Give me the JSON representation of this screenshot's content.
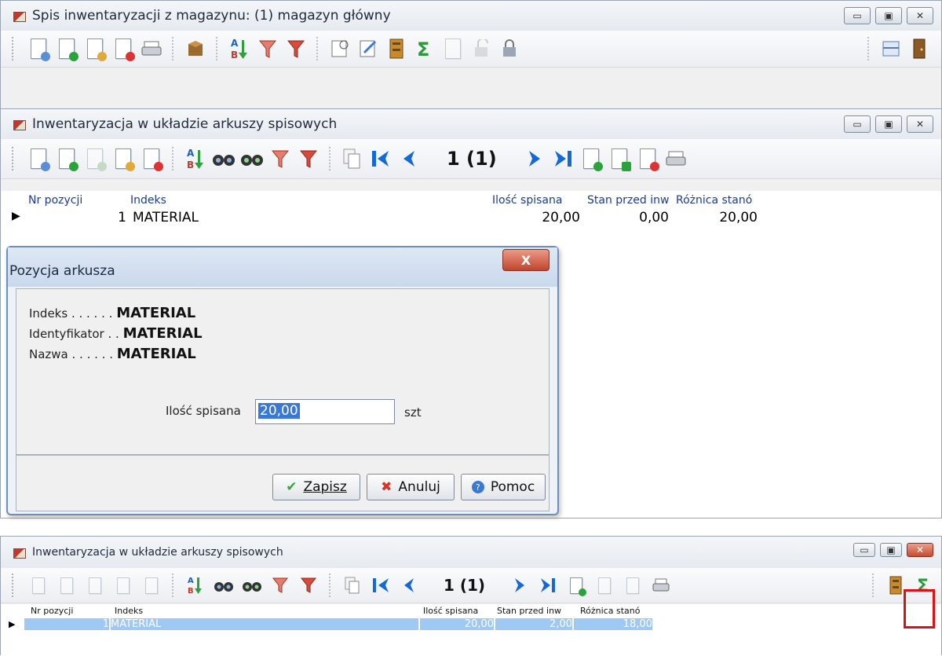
{
  "win1": {
    "title": "Spis inwentaryzacji z magazynu: (1) magazyn główny"
  },
  "win2": {
    "title": "Inwentaryzacja w układzie arkuszy spisowych",
    "page_indicator": "1 (1)",
    "columns": [
      "Nr pozycji",
      "Indeks",
      "Ilość spisana",
      "Stan przed inw",
      "Różnica stanó"
    ],
    "rows": [
      {
        "nr": "1",
        "indeks": "MATERIAL",
        "ilosc": "20,00",
        "stan": "0,00",
        "roznica": "20,00"
      }
    ]
  },
  "dialog": {
    "title": "Pozycja arkusza",
    "close": "X",
    "indeks_label": "Indeks . . . . . .",
    "indeks_value": "MATERIAL",
    "ident_label": "Identyfikator . .",
    "ident_value": "MATERIAL",
    "nazwa_label": "Nazwa . . . . . .",
    "nazwa_value": "MATERIAL",
    "qty_label": "Ilość spisana",
    "qty_value": "20,00",
    "unit": "szt",
    "save_label": "Zapisz",
    "cancel_label": "Anuluj",
    "help_label": "Pomoc"
  },
  "win3": {
    "title": "Inwentaryzacja w układzie arkuszy spisowych",
    "page_indicator": "1 (1)",
    "columns": [
      "Nr pozycji",
      "Indeks",
      "Ilość spisana",
      "Stan przed inw",
      "Różnica stanó"
    ],
    "rows": [
      {
        "nr": "1",
        "indeks": "MATERIAL",
        "ilosc": "20,00",
        "stan": "2,00",
        "roznica": "18,00"
      }
    ]
  },
  "colors": {
    "accent_blue": "#1569d6",
    "highlight_red": "#dd1111",
    "selection": "#9fc8f2"
  }
}
